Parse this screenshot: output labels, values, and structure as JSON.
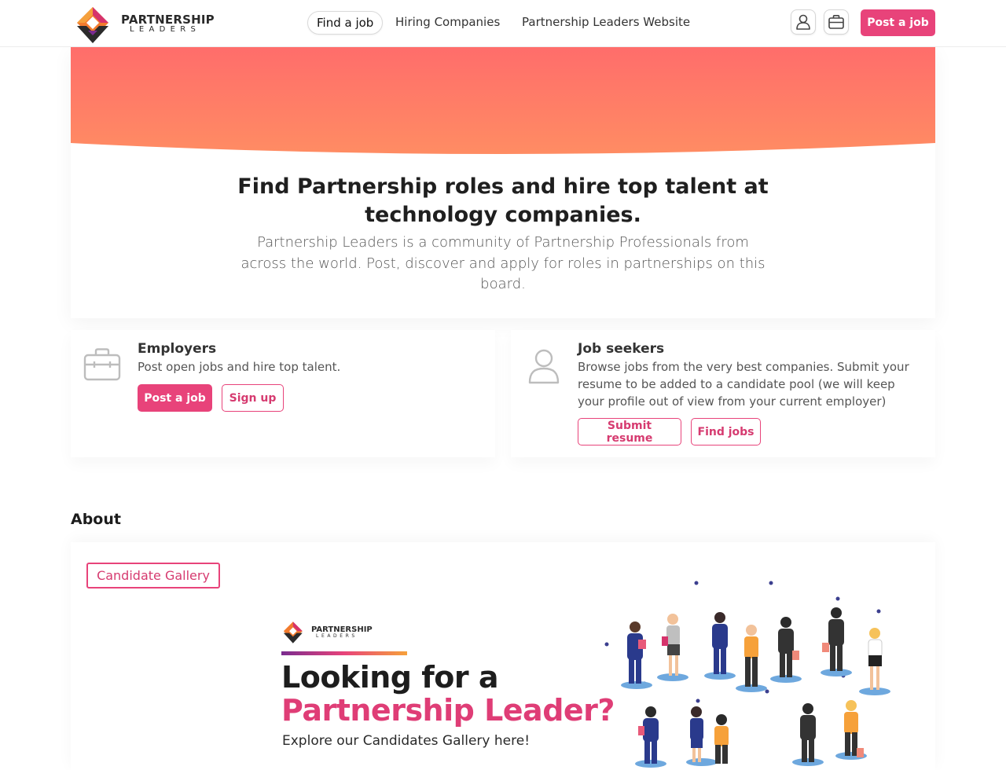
{
  "brand": {
    "name_line1": "PARTNERSHIP",
    "name_line2": "LEADERS",
    "colors": {
      "accent": "#e8437a",
      "banner_start": "#ff6b6b",
      "banner_end": "#ff8e62",
      "logo_orange": "#f27b2e",
      "logo_purple": "#7a2c8f"
    }
  },
  "nav": {
    "items": [
      {
        "label": "Find a job",
        "active": true
      },
      {
        "label": "Hiring Companies",
        "active": false
      },
      {
        "label": "Partnership Leaders Website",
        "active": false
      }
    ],
    "icons": {
      "account": "user-icon",
      "jobs": "briefcase-icon"
    },
    "post_job_label": "Post a job"
  },
  "hero": {
    "title": "Find Partnership roles and hire top talent at technology companies.",
    "subtitle": "Partnership Leaders is a community of Partnership Professionals from across the world. Post, discover and apply for roles in partnerships on this board."
  },
  "employers": {
    "icon": "briefcase-icon",
    "title": "Employers",
    "text": "Post open jobs and hire top talent.",
    "post_label": "Post a job",
    "signup_label": "Sign up"
  },
  "job_seekers": {
    "icon": "user-icon",
    "title": "Job seekers",
    "text": "Browse jobs from the very best companies. Submit your resume to be added to a candidate pool (we will keep your profile out of view from your current employer)",
    "submit_label": "Submit resume",
    "find_label": "Find jobs"
  },
  "about": {
    "heading": "About",
    "gallery_button": "Candidate Gallery",
    "promo": {
      "brand_line1": "PARTNERSHIP",
      "brand_line2": "LEADERS",
      "headline_1": "Looking for a",
      "headline_2": "Partnership Leader?",
      "subline": "Explore our Candidates Gallery here!"
    }
  }
}
